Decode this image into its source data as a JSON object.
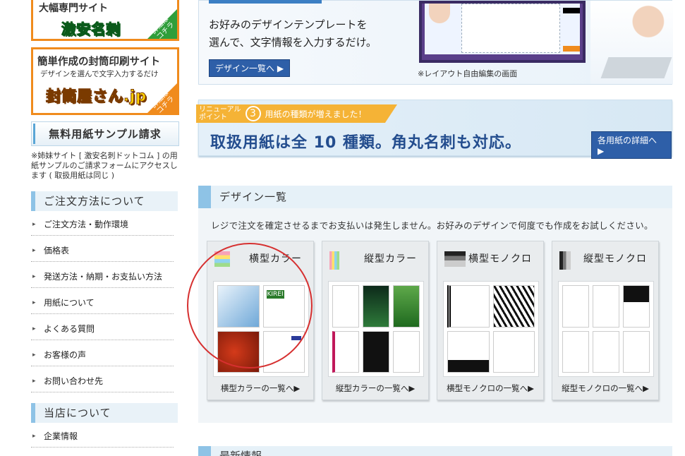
{
  "sidebar": {
    "banner1": {
      "title": "大幅専門サイト",
      "logo": "激安名刺",
      "badge": "詳細はコチラ"
    },
    "banner2": {
      "title": "簡単作成の封筒印刷サイト",
      "subtitle": "デザインを選んで文字入力するだけ",
      "logo": "封筒屋さん.jp",
      "badge": "詳細はコチラ"
    },
    "sample_button": "無料用紙サンプル請求",
    "note": "※姉妹サイト [ 激安名刺ドットコム ] の用紙サンプルのご請求フォームにアクセスします ( 取扱用紙は同じ )",
    "order_heading": "ご注文方法について",
    "order_items": [
      "ご注文方法・動作環境",
      "価格表",
      "発送方法・納期・お支払い方法",
      "用紙について",
      "よくある質問",
      "お客様の声",
      "お問い合わせ先"
    ],
    "store_heading": "当店について",
    "store_items": [
      "企業情報"
    ]
  },
  "hero": {
    "line1": "お好みのデザインテンプレートを",
    "line2": "選んで、文字情報を入力するだけ。",
    "button": "デザイン一覧へ ▶",
    "caption": "※レイアウト自由編集の画面"
  },
  "renewal": {
    "label_small": "リニューアル\nポイント",
    "number": "3",
    "label": "用紙の種類が増えました！",
    "headline": "取扱用紙は全 10 種類。角丸名刺も対応。",
    "button": "各用紙の詳細へ ▶"
  },
  "design": {
    "heading": "デザイン一覧",
    "note": "レジで注文を確定させるまでお支払いは発生しません。お好みのデザインで何度でも作成をお試しください。",
    "cards": [
      {
        "title": "横型カラー",
        "link": "横型カラーの一覧へ▶"
      },
      {
        "title": "縦型カラー",
        "link": "縦型カラーの一覧へ▶"
      },
      {
        "title": "横型モノクロ",
        "link": "横型モノクロの一覧へ▶"
      },
      {
        "title": "縦型モノクロ",
        "link": "縦型モノクロの一覧へ▶"
      }
    ]
  },
  "news_heading": "最新情報",
  "colors": {
    "orange": "#f08b1d",
    "blue": "#2e5fa8",
    "accent_light": "#8ec3e6",
    "red_circle": "#d63030"
  }
}
